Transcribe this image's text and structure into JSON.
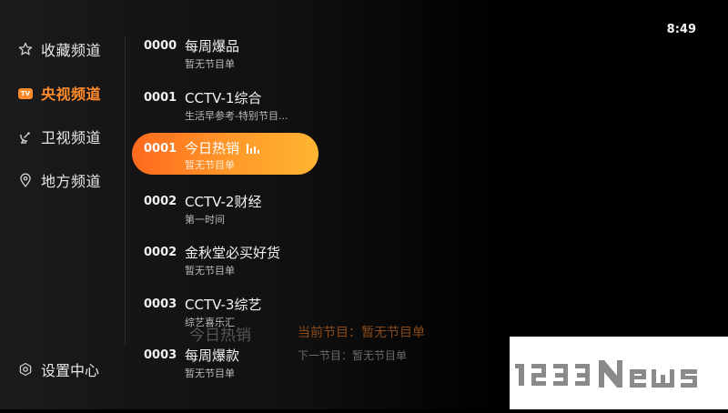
{
  "clock": "8:49",
  "sidebar": {
    "items": [
      {
        "label": "收藏频道",
        "icon": "star-icon"
      },
      {
        "label": "央视频道",
        "icon": "tv-badge-icon",
        "badge": "TV"
      },
      {
        "label": "卫视频道",
        "icon": "satellite-icon"
      },
      {
        "label": "地方频道",
        "icon": "location-pin-icon"
      }
    ],
    "settings_label": "设置中心"
  },
  "channels": [
    {
      "num": "0000",
      "name": "每周爆品",
      "program": "暂无节目单"
    },
    {
      "num": "0001",
      "name": "CCTV-1综合",
      "program": "生活早参考-特别节目..."
    },
    {
      "num": "0001",
      "name": "今日热销",
      "program": "暂无节目单"
    },
    {
      "num": "0002",
      "name": "CCTV-2财经",
      "program": "第一时间"
    },
    {
      "num": "0002",
      "name": "金秋堂必买好货",
      "program": "暂无节目单"
    },
    {
      "num": "0003",
      "name": "CCTV-3综艺",
      "program": "综艺喜乐汇"
    },
    {
      "num": "0003",
      "name": "每周爆款",
      "program": "暂无节目单"
    }
  ],
  "info": {
    "channel_title": "今日热销",
    "current_program": "当前节目：暂无节目单",
    "next_program": "下一节目：暂无节目单"
  },
  "watermark": "1233News",
  "colors": {
    "accent": "#ff8a2a"
  }
}
